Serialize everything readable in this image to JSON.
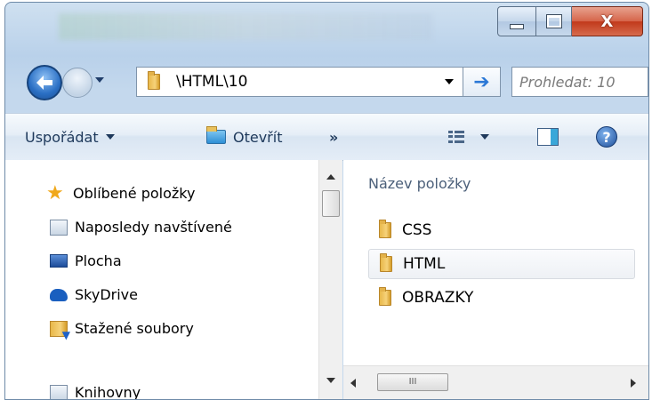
{
  "window": {
    "caption_buttons": {
      "minimize_icon": "minimize-icon",
      "maximize_icon": "maximize-icon",
      "close_glyph": "X"
    }
  },
  "navigation": {
    "back_icon": "back-arrow-icon",
    "forward_icon": "forward-arrow-icon",
    "address": "\\HTML\\10",
    "search_placeholder": "Prohledat: 10"
  },
  "toolbar": {
    "organize_label": "Uspořádat",
    "open_label": "Otevřít",
    "more_label": "»",
    "help_glyph": "?"
  },
  "nav_pane": {
    "items": [
      {
        "label": "Oblíbené položky",
        "icon": "star-icon"
      },
      {
        "label": "Naposledy navštívené",
        "icon": "recent-places-icon"
      },
      {
        "label": "Plocha",
        "icon": "desktop-icon"
      },
      {
        "label": "SkyDrive",
        "icon": "skydrive-icon"
      },
      {
        "label": "Stažené soubory",
        "icon": "downloads-icon"
      },
      {
        "label": "Knihovny",
        "icon": "libraries-icon"
      }
    ]
  },
  "file_list": {
    "column_header": "Název položky",
    "items": [
      {
        "name": "CSS"
      },
      {
        "name": "HTML"
      },
      {
        "name": "OBRAZKY"
      }
    ]
  },
  "scrollbars": {
    "h_thumb_grip": "III"
  },
  "colors": {
    "accent": "#2b78d6",
    "close_button": "#c1391b",
    "toolbar_text": "#1e395b"
  }
}
